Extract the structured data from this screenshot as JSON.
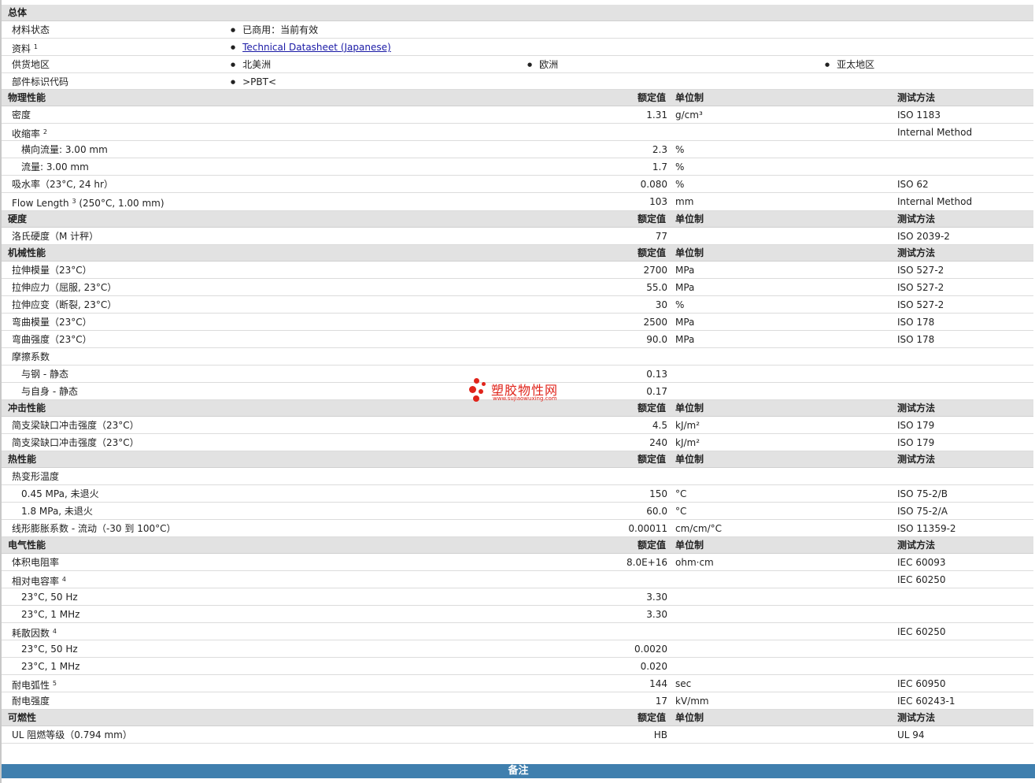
{
  "general": {
    "title": "总体",
    "status_label": "材料状态",
    "status_value": "已商用：当前有效",
    "info_label": "资料",
    "info_sup": "1",
    "info_link": "Technical Datasheet (Japanese)",
    "supply_label": "供货地区",
    "supply_1": "北美洲",
    "supply_2": "欧洲",
    "supply_3": "亚太地区",
    "part_label": "部件标识代码",
    "part_value": ">PBT<"
  },
  "headers": {
    "nominal": "额定值",
    "unit": "单位制",
    "method": "测试方法"
  },
  "physical": {
    "title": "物理性能",
    "rows": [
      {
        "label": "密度",
        "value": "1.31",
        "unit": "g/cm³",
        "method": "ISO 1183"
      },
      {
        "label": "收缩率",
        "sup": "2",
        "value": "",
        "unit": "",
        "method": "Internal Method"
      },
      {
        "label": "横向流量: 3.00 mm",
        "value": "2.3",
        "unit": "%",
        "method": ""
      },
      {
        "label": "流量: 3.00 mm",
        "value": "1.7",
        "unit": "%",
        "method": ""
      },
      {
        "label": "吸水率（23°C, 24 hr）",
        "value": "0.080",
        "unit": "%",
        "method": "ISO 62"
      },
      {
        "label": "Flow Length",
        "sup": "3",
        "label_tail": "(250°C, 1.00 mm)",
        "value": "103",
        "unit": "mm",
        "method": "Internal Method"
      }
    ]
  },
  "hardness": {
    "title": "硬度",
    "rows": [
      {
        "label": "洛氏硬度（M 计秤）",
        "value": "77",
        "unit": "",
        "method": "ISO 2039-2"
      }
    ]
  },
  "mechanical": {
    "title": "机械性能",
    "rows": [
      {
        "label": "拉伸模量（23°C）",
        "value": "2700",
        "unit": "MPa",
        "method": "ISO 527-2"
      },
      {
        "label": "拉伸应力（屈服, 23°C）",
        "value": "55.0",
        "unit": "MPa",
        "method": "ISO 527-2"
      },
      {
        "label": "拉伸应变（断裂, 23°C）",
        "value": "30",
        "unit": "%",
        "method": "ISO 527-2"
      },
      {
        "label": "弯曲模量（23°C）",
        "value": "2500",
        "unit": "MPa",
        "method": "ISO 178"
      },
      {
        "label": "弯曲强度（23°C）",
        "value": "90.0",
        "unit": "MPa",
        "method": "ISO 178"
      },
      {
        "label": "摩擦系数",
        "value": "",
        "unit": "",
        "method": ""
      },
      {
        "label": "与钢 - 静态",
        "value": "0.13",
        "unit": "",
        "method": ""
      },
      {
        "label": "与自身 - 静态",
        "value": "0.17",
        "unit": "",
        "method": ""
      }
    ]
  },
  "impact": {
    "title": "冲击性能",
    "rows": [
      {
        "label": "简支梁缺口冲击强度（23°C）",
        "value": "4.5",
        "unit": "kJ/m²",
        "method": "ISO 179"
      },
      {
        "label": "简支梁缺口冲击强度（23°C）",
        "value": "240",
        "unit": "kJ/m²",
        "method": "ISO 179"
      }
    ]
  },
  "thermal": {
    "title": "热性能",
    "rows": [
      {
        "label": "热变形温度",
        "value": "",
        "unit": "",
        "method": ""
      },
      {
        "label": "0.45 MPa, 未退火",
        "value": "150",
        "unit": "°C",
        "method": "ISO 75-2/B"
      },
      {
        "label": "1.8 MPa, 未退火",
        "value": "60.0",
        "unit": "°C",
        "method": "ISO 75-2/A"
      },
      {
        "label": "线形膨胀系数 - 流动（-30 到 100°C）",
        "value": "0.00011",
        "unit": "cm/cm/°C",
        "method": "ISO 11359-2"
      }
    ]
  },
  "electrical": {
    "title": "电气性能",
    "rows": [
      {
        "label": "体积电阻率",
        "value": "8.0E+16",
        "unit": "ohm·cm",
        "method": "IEC 60093"
      },
      {
        "label": "相对电容率",
        "sup": "4",
        "value": "",
        "unit": "",
        "method": "IEC 60250"
      },
      {
        "label": "23°C, 50 Hz",
        "value": "3.30",
        "unit": "",
        "method": ""
      },
      {
        "label": "23°C, 1 MHz",
        "value": "3.30",
        "unit": "",
        "method": ""
      },
      {
        "label": "耗散因数",
        "sup": "4",
        "value": "",
        "unit": "",
        "method": "IEC 60250"
      },
      {
        "label": "23°C, 50 Hz",
        "value": "0.0020",
        "unit": "",
        "method": ""
      },
      {
        "label": "23°C, 1 MHz",
        "value": "0.020",
        "unit": "",
        "method": ""
      },
      {
        "label": "耐电弧性",
        "sup": "5",
        "value": "144",
        "unit": "sec",
        "method": "IEC 60950"
      },
      {
        "label": "耐电强度",
        "value": "17",
        "unit": "kV/mm",
        "method": "IEC 60243-1"
      }
    ]
  },
  "flammability": {
    "title": "可燃性",
    "rows": [
      {
        "label": "UL 阻燃等级（0.794 mm）",
        "value": "HB",
        "unit": "",
        "method": "UL 94"
      }
    ]
  },
  "footer": {
    "notes": "备注"
  },
  "watermark": {
    "brand": "塑胶物性网",
    "url": "www.sujiaowuxing.com"
  },
  "colors": {
    "header_bg": "#e2e2e2",
    "footer_bg": "#3f7fae",
    "link": "#1a1aa6",
    "watermark": "#e0241b"
  }
}
